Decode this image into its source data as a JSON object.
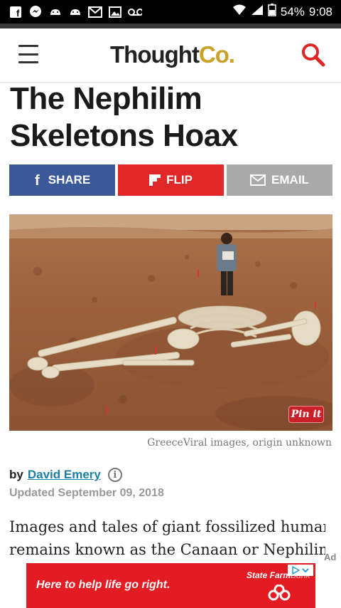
{
  "status_bar": {
    "battery": "54%",
    "time": "9:08",
    "icons": [
      "facebook-icon",
      "messenger-icon",
      "android-icon",
      "android-icon",
      "gmail-icon",
      "image-icon",
      "voicemail-icon",
      "wifi-icon",
      "signal-icon",
      "battery-icon"
    ]
  },
  "header": {
    "logo_main": "Thought",
    "logo_accent": "Co.",
    "colors": {
      "accent": "#c9a227",
      "search": "#e02525"
    }
  },
  "article": {
    "title_line1": "The Nephilim",
    "title_line2": "Skeletons Hoax",
    "share": {
      "facebook": "SHARE",
      "flip": "FLIP",
      "email": "EMAIL",
      "colors": {
        "facebook": "#3b5998",
        "flip": "#e12828",
        "email": "#a9a9a9"
      }
    },
    "image_caption": "GreeceViral images, origin unknown",
    "pin_label": "Pin it",
    "byline_prefix": "by",
    "author": "David Emery",
    "updated": "Updated September 09, 2018",
    "body_line1": "Images and tales of giant fossilized human",
    "body_line2": "remains known as the Canaan or Nephilim"
  },
  "ad": {
    "label": "Ad",
    "headline": "Here to help life go right.",
    "brand": "State Farm",
    "brand_suffix": "Bank",
    "color": "#e31b23"
  }
}
